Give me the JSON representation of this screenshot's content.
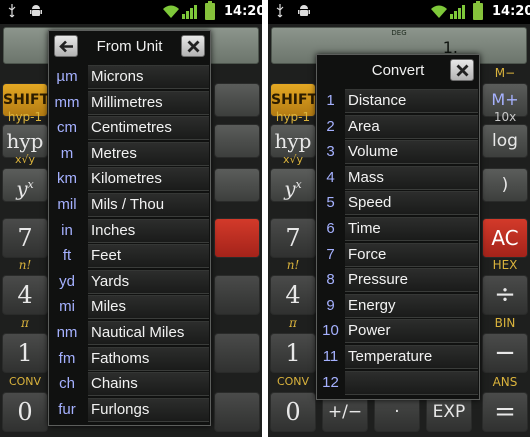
{
  "status_bar": {
    "time": "14:20"
  },
  "left_screen": {
    "calculator": {
      "keys": {
        "shift": "SHIFT",
        "hyp_inv": "hyp-1",
        "hyp": "hyp",
        "root": "x√y",
        "power": "y",
        "power_exp": "x",
        "seven": "7",
        "factorial": "n!",
        "four": "4",
        "pi": "π",
        "one": "1",
        "conv": "CONV",
        "zero": "0"
      }
    },
    "dialog": {
      "title": "From Unit",
      "units": [
        {
          "symbol": "µm",
          "name": "Microns"
        },
        {
          "symbol": "mm",
          "name": "Millimetres"
        },
        {
          "symbol": "cm",
          "name": "Centimetres"
        },
        {
          "symbol": "m",
          "name": "Metres"
        },
        {
          "symbol": "km",
          "name": "Kilometres"
        },
        {
          "symbol": "mil",
          "name": "Mils / Thou"
        },
        {
          "symbol": "in",
          "name": "Inches"
        },
        {
          "symbol": "ft",
          "name": "Feet"
        },
        {
          "symbol": "yd",
          "name": "Yards"
        },
        {
          "symbol": "mi",
          "name": "Miles"
        },
        {
          "symbol": "nm",
          "name": "Nautical Miles"
        },
        {
          "symbol": "fm",
          "name": "Fathoms"
        },
        {
          "symbol": "ch",
          "name": "Chains"
        },
        {
          "symbol": "fur",
          "name": "Furlongs"
        }
      ]
    }
  },
  "right_screen": {
    "calculator": {
      "display_mode": "DEG",
      "display_value": "1.",
      "keys": {
        "m_minus": "M−",
        "m_plus": "M+",
        "ten_power": "10x",
        "log": "log",
        "close_paren": ")",
        "ac": "AC",
        "hex": "HEX",
        "divide": "÷",
        "bin": "BIN",
        "minus": "−",
        "ans": "ANS",
        "equals": "=",
        "zero": "0",
        "plus_minus": "+/−",
        "dot": "·",
        "exp": "EXP"
      },
      "left_keys": {
        "shift": "SHIFT",
        "hyp_inv": "hyp-1",
        "hyp": "hyp",
        "root": "x√y",
        "power": "y",
        "power_exp": "x",
        "seven": "7",
        "factorial": "n!",
        "four": "4",
        "pi": "π",
        "one": "1",
        "conv": "CONV"
      }
    },
    "dialog": {
      "title": "Convert",
      "categories": [
        {
          "number": "1",
          "name": "Distance"
        },
        {
          "number": "2",
          "name": "Area"
        },
        {
          "number": "3",
          "name": "Volume"
        },
        {
          "number": "4",
          "name": "Mass"
        },
        {
          "number": "5",
          "name": "Speed"
        },
        {
          "number": "6",
          "name": "Time"
        },
        {
          "number": "7",
          "name": "Force"
        },
        {
          "number": "8",
          "name": "Pressure"
        },
        {
          "number": "9",
          "name": "Energy"
        },
        {
          "number": "10",
          "name": "Power"
        },
        {
          "number": "11",
          "name": "Temperature"
        },
        {
          "number": "12",
          "name": ""
        }
      ]
    }
  },
  "colors": {
    "accent_blue": "#a5b1ff",
    "key_red": "#d33a2a",
    "key_yellow": "#e4a823",
    "battery_green": "#86c23b"
  }
}
